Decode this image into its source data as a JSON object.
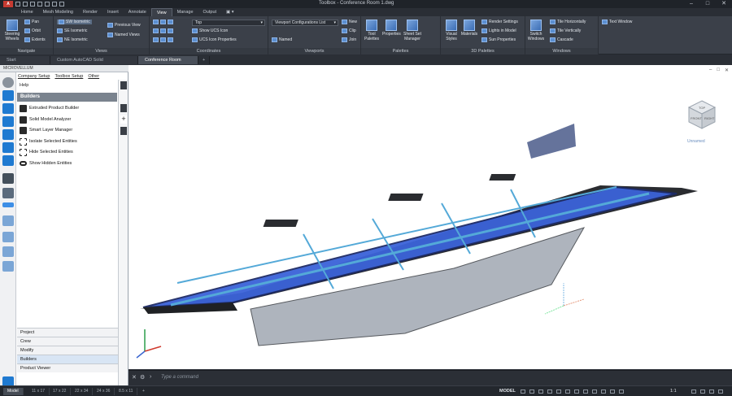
{
  "titlebar": {
    "title": "Toolbox - Conference Room 1.dwg",
    "logo": "A"
  },
  "ribbon_tabs": [
    "Home",
    "Mesh Modeling",
    "Render",
    "Insert",
    "Annotate",
    "View",
    "Manage",
    "Output"
  ],
  "active_tab": "View",
  "panels": {
    "navigate": {
      "label": "Navigate",
      "steering": "Steering Wheels",
      "pan": "Pan",
      "orbit": "Orbit",
      "extents": "Extents"
    },
    "views": {
      "label": "Views",
      "sw_isometric": "SW Isometric",
      "se_isometric": "SE Isometric",
      "ne_isometric": "NE Isometric",
      "previous_view": "Previous View",
      "named_views": "Named Views"
    },
    "coordinates": {
      "label": "Coordinates",
      "ucs_dropdown": "Top",
      "show_ucs_icon": "Show UCS Icon",
      "ucs_icon_properties": "UCS Icon Properties"
    },
    "viewports": {
      "label": "Viewports",
      "config_list": "Viewport Configurations List",
      "named": "Named",
      "new": "New",
      "clip": "Clip",
      "join": "Join"
    },
    "palettes": {
      "label": "Palettes",
      "tool_palettes": "Tool Palettes",
      "properties": "Properties",
      "sheet_set_manager": "Sheet Set Manager"
    },
    "palettes3d": {
      "label": "3D Palettes",
      "visual_styles": "Visual Styles",
      "materials": "Materials",
      "render_settings": "Render Settings",
      "lights_in_model": "Lights in Model",
      "sun_properties": "Sun Properties"
    },
    "windows": {
      "label": "Windows",
      "switch_windows": "Switch Windows",
      "tile_horizontally": "Tile Horizontally",
      "tile_vertically": "Tile Vertically",
      "cascade": "Cascade",
      "text_window": "Text Window"
    }
  },
  "doc_tabs": [
    "Start",
    "Custom AutoCAD Solid Examples*",
    "Conference Room 1*"
  ],
  "palette": {
    "title": "MICROVELLUM",
    "menu": [
      "Company Setup",
      "Toolbox Setup",
      "Other"
    ],
    "help": "Help",
    "section": "Builders",
    "tools": [
      "Extruded Product Builder",
      "Solid Model Analyzer",
      "Smart Layer Manager",
      "Isolate Selected Entities",
      "Hide Selected Entities",
      "Show Hidden Entities"
    ],
    "bottom_sections": [
      "Project",
      "Crew",
      "Modify",
      "Builders",
      "Product Viewer"
    ]
  },
  "viewport": {
    "viewcube_top": "TOP",
    "viewcube_front": "FRONT",
    "viewcube_right": "RIGHT",
    "unnamed": "Unnamed"
  },
  "command_line": {
    "placeholder": "Type a command"
  },
  "status": {
    "layout_tabs": [
      "Model",
      "11 x 17",
      "17 x 22",
      "22 x 34",
      "24 x 36",
      "8.5 x 11"
    ],
    "model": "MODEL",
    "scale": "1:1"
  }
}
